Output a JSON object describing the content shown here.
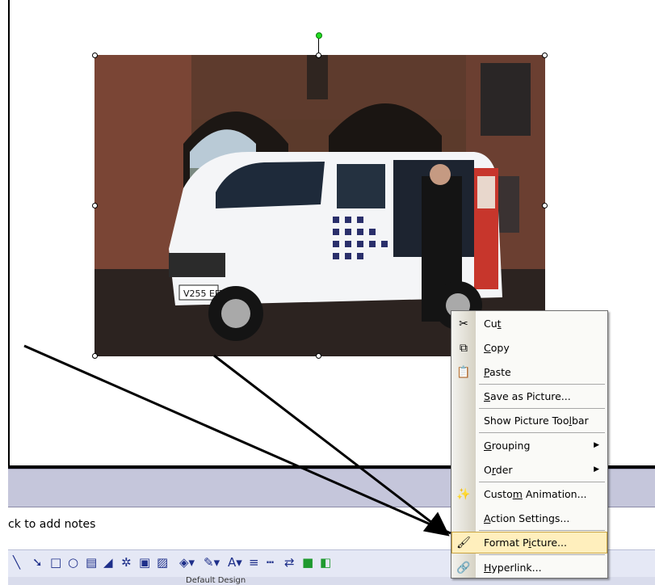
{
  "notes": {
    "placeholder": "ck to add notes"
  },
  "status": {
    "design": "Default Design"
  },
  "context_menu": {
    "items": [
      {
        "pre": "Cu",
        "acc": "t",
        "post": "",
        "icon": "scissors-icon"
      },
      {
        "pre": "",
        "acc": "C",
        "post": "opy",
        "icon": "copy-icon"
      },
      {
        "pre": "",
        "acc": "P",
        "post": "aste",
        "icon": "paste-icon"
      },
      {
        "pre": "",
        "acc": "S",
        "post": "ave as Picture...",
        "icon": ""
      },
      {
        "pre": "Show Picture Too",
        "acc": "l",
        "post": "bar",
        "icon": ""
      },
      {
        "pre": "",
        "acc": "G",
        "post": "rouping",
        "icon": "",
        "submenu": true
      },
      {
        "pre": "O",
        "acc": "r",
        "post": "der",
        "icon": "",
        "submenu": true
      },
      {
        "pre": "Custo",
        "acc": "m",
        "post": " Animation...",
        "icon": "custom-animation-icon"
      },
      {
        "pre": "",
        "acc": "A",
        "post": "ction Settings...",
        "icon": ""
      },
      {
        "pre": "Format P",
        "acc": "i",
        "post": "cture...",
        "icon": "format-picture-icon",
        "highlighted": true
      },
      {
        "pre": "",
        "acc": "H",
        "post": "yperlink...",
        "icon": "hyperlink-icon"
      }
    ]
  },
  "colors": {
    "highlight": "#ffefbd",
    "notes_band": "#c5c6db"
  }
}
